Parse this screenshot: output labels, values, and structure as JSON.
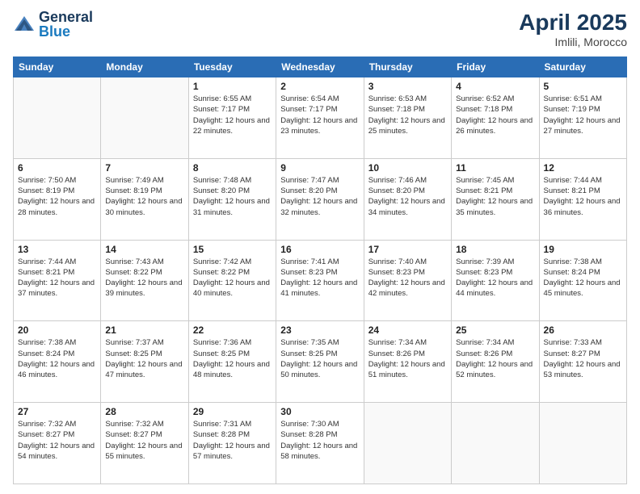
{
  "header": {
    "logo": {
      "general": "General",
      "blue": "Blue"
    },
    "title": "April 2025",
    "location": "Imlili, Morocco"
  },
  "days_of_week": [
    "Sunday",
    "Monday",
    "Tuesday",
    "Wednesday",
    "Thursday",
    "Friday",
    "Saturday"
  ],
  "weeks": [
    [
      {
        "day": "",
        "sunrise": "",
        "sunset": "",
        "daylight": ""
      },
      {
        "day": "",
        "sunrise": "",
        "sunset": "",
        "daylight": ""
      },
      {
        "day": "1",
        "sunrise": "Sunrise: 6:55 AM",
        "sunset": "Sunset: 7:17 PM",
        "daylight": "Daylight: 12 hours and 22 minutes."
      },
      {
        "day": "2",
        "sunrise": "Sunrise: 6:54 AM",
        "sunset": "Sunset: 7:17 PM",
        "daylight": "Daylight: 12 hours and 23 minutes."
      },
      {
        "day": "3",
        "sunrise": "Sunrise: 6:53 AM",
        "sunset": "Sunset: 7:18 PM",
        "daylight": "Daylight: 12 hours and 25 minutes."
      },
      {
        "day": "4",
        "sunrise": "Sunrise: 6:52 AM",
        "sunset": "Sunset: 7:18 PM",
        "daylight": "Daylight: 12 hours and 26 minutes."
      },
      {
        "day": "5",
        "sunrise": "Sunrise: 6:51 AM",
        "sunset": "Sunset: 7:19 PM",
        "daylight": "Daylight: 12 hours and 27 minutes."
      }
    ],
    [
      {
        "day": "6",
        "sunrise": "Sunrise: 7:50 AM",
        "sunset": "Sunset: 8:19 PM",
        "daylight": "Daylight: 12 hours and 28 minutes."
      },
      {
        "day": "7",
        "sunrise": "Sunrise: 7:49 AM",
        "sunset": "Sunset: 8:19 PM",
        "daylight": "Daylight: 12 hours and 30 minutes."
      },
      {
        "day": "8",
        "sunrise": "Sunrise: 7:48 AM",
        "sunset": "Sunset: 8:20 PM",
        "daylight": "Daylight: 12 hours and 31 minutes."
      },
      {
        "day": "9",
        "sunrise": "Sunrise: 7:47 AM",
        "sunset": "Sunset: 8:20 PM",
        "daylight": "Daylight: 12 hours and 32 minutes."
      },
      {
        "day": "10",
        "sunrise": "Sunrise: 7:46 AM",
        "sunset": "Sunset: 8:20 PM",
        "daylight": "Daylight: 12 hours and 34 minutes."
      },
      {
        "day": "11",
        "sunrise": "Sunrise: 7:45 AM",
        "sunset": "Sunset: 8:21 PM",
        "daylight": "Daylight: 12 hours and 35 minutes."
      },
      {
        "day": "12",
        "sunrise": "Sunrise: 7:44 AM",
        "sunset": "Sunset: 8:21 PM",
        "daylight": "Daylight: 12 hours and 36 minutes."
      }
    ],
    [
      {
        "day": "13",
        "sunrise": "Sunrise: 7:44 AM",
        "sunset": "Sunset: 8:21 PM",
        "daylight": "Daylight: 12 hours and 37 minutes."
      },
      {
        "day": "14",
        "sunrise": "Sunrise: 7:43 AM",
        "sunset": "Sunset: 8:22 PM",
        "daylight": "Daylight: 12 hours and 39 minutes."
      },
      {
        "day": "15",
        "sunrise": "Sunrise: 7:42 AM",
        "sunset": "Sunset: 8:22 PM",
        "daylight": "Daylight: 12 hours and 40 minutes."
      },
      {
        "day": "16",
        "sunrise": "Sunrise: 7:41 AM",
        "sunset": "Sunset: 8:23 PM",
        "daylight": "Daylight: 12 hours and 41 minutes."
      },
      {
        "day": "17",
        "sunrise": "Sunrise: 7:40 AM",
        "sunset": "Sunset: 8:23 PM",
        "daylight": "Daylight: 12 hours and 42 minutes."
      },
      {
        "day": "18",
        "sunrise": "Sunrise: 7:39 AM",
        "sunset": "Sunset: 8:23 PM",
        "daylight": "Daylight: 12 hours and 44 minutes."
      },
      {
        "day": "19",
        "sunrise": "Sunrise: 7:38 AM",
        "sunset": "Sunset: 8:24 PM",
        "daylight": "Daylight: 12 hours and 45 minutes."
      }
    ],
    [
      {
        "day": "20",
        "sunrise": "Sunrise: 7:38 AM",
        "sunset": "Sunset: 8:24 PM",
        "daylight": "Daylight: 12 hours and 46 minutes."
      },
      {
        "day": "21",
        "sunrise": "Sunrise: 7:37 AM",
        "sunset": "Sunset: 8:25 PM",
        "daylight": "Daylight: 12 hours and 47 minutes."
      },
      {
        "day": "22",
        "sunrise": "Sunrise: 7:36 AM",
        "sunset": "Sunset: 8:25 PM",
        "daylight": "Daylight: 12 hours and 48 minutes."
      },
      {
        "day": "23",
        "sunrise": "Sunrise: 7:35 AM",
        "sunset": "Sunset: 8:25 PM",
        "daylight": "Daylight: 12 hours and 50 minutes."
      },
      {
        "day": "24",
        "sunrise": "Sunrise: 7:34 AM",
        "sunset": "Sunset: 8:26 PM",
        "daylight": "Daylight: 12 hours and 51 minutes."
      },
      {
        "day": "25",
        "sunrise": "Sunrise: 7:34 AM",
        "sunset": "Sunset: 8:26 PM",
        "daylight": "Daylight: 12 hours and 52 minutes."
      },
      {
        "day": "26",
        "sunrise": "Sunrise: 7:33 AM",
        "sunset": "Sunset: 8:27 PM",
        "daylight": "Daylight: 12 hours and 53 minutes."
      }
    ],
    [
      {
        "day": "27",
        "sunrise": "Sunrise: 7:32 AM",
        "sunset": "Sunset: 8:27 PM",
        "daylight": "Daylight: 12 hours and 54 minutes."
      },
      {
        "day": "28",
        "sunrise": "Sunrise: 7:32 AM",
        "sunset": "Sunset: 8:27 PM",
        "daylight": "Daylight: 12 hours and 55 minutes."
      },
      {
        "day": "29",
        "sunrise": "Sunrise: 7:31 AM",
        "sunset": "Sunset: 8:28 PM",
        "daylight": "Daylight: 12 hours and 57 minutes."
      },
      {
        "day": "30",
        "sunrise": "Sunrise: 7:30 AM",
        "sunset": "Sunset: 8:28 PM",
        "daylight": "Daylight: 12 hours and 58 minutes."
      },
      {
        "day": "",
        "sunrise": "",
        "sunset": "",
        "daylight": ""
      },
      {
        "day": "",
        "sunrise": "",
        "sunset": "",
        "daylight": ""
      },
      {
        "day": "",
        "sunrise": "",
        "sunset": "",
        "daylight": ""
      }
    ]
  ]
}
